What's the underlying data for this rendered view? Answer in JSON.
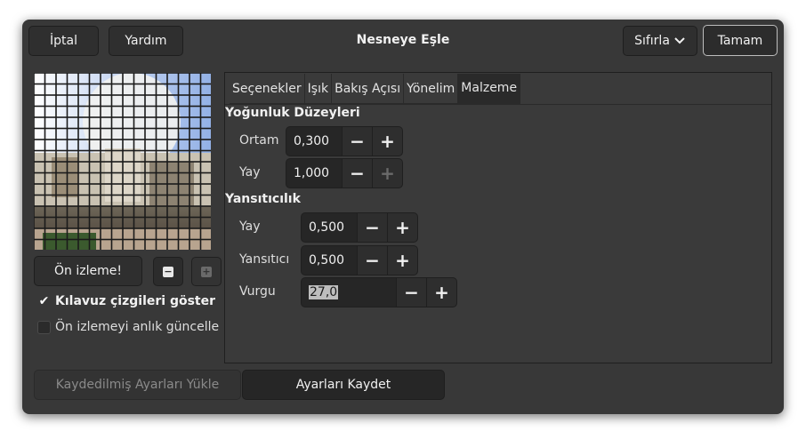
{
  "header": {
    "cancel_label": "İptal",
    "help_label": "Yardım",
    "title": "Nesneye Eşle",
    "reset_label": "Sıfırla",
    "ok_label": "Tamam"
  },
  "preview": {
    "preview_button_label": "Ön izleme!",
    "zoom_out_icon": "minus-square-icon",
    "zoom_in_icon": "plus-square-icon",
    "show_guides_label": "Kılavuz çizgileri göster",
    "show_guides_checked": true,
    "live_update_label": "Ön izlemeyi anlık güncelle",
    "live_update_checked": false
  },
  "tabs": [
    {
      "label": "Seçenekler"
    },
    {
      "label": "Işık"
    },
    {
      "label": "Bakış Açısı"
    },
    {
      "label": "Yönelim"
    },
    {
      "label": "Malzeme"
    }
  ],
  "active_tab": "Malzeme",
  "material": {
    "intensity_title": "Yoğunluk Düzeyleri",
    "ambient_label": "Ortam",
    "ambient_value": "0,300",
    "diffuse_label": "Yay",
    "diffuse_value": "1,000",
    "reflectivity_title": "Yansıtıcılık",
    "refl_diffuse_label": "Yay",
    "refl_diffuse_value": "0,500",
    "specular_label": "Yansıtıcı",
    "specular_value": "0,500",
    "highlight_label": "Vurgu",
    "highlight_value": "27,0"
  },
  "footer": {
    "load_label": "Kaydedilmiş Ayarları Yükle",
    "save_label": "Ayarları Kaydet"
  },
  "colors": {
    "dialog_bg": "#383838",
    "button_bg": "#2f2f2f",
    "field_bg": "#262626",
    "preview_sky": "#9db8e8"
  }
}
